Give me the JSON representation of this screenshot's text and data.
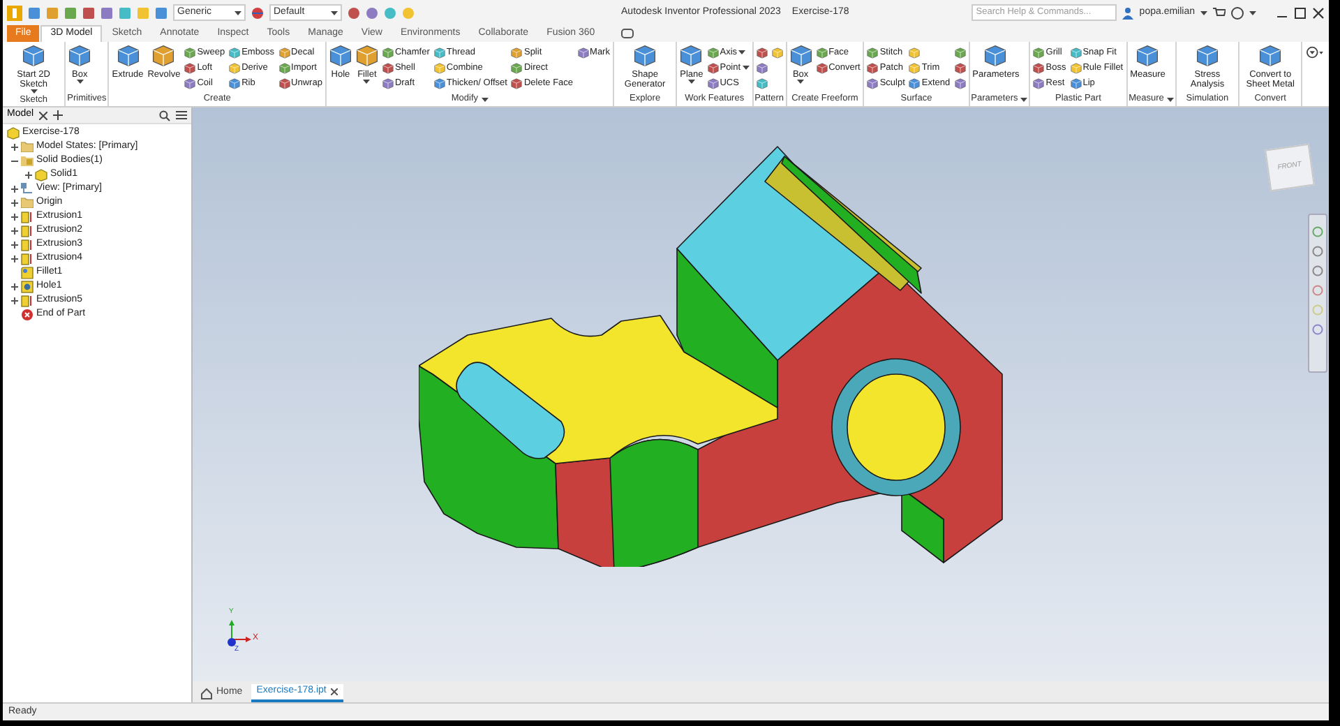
{
  "quick_access": {
    "material": "Generic",
    "appearance": "Default"
  },
  "title": {
    "app": "Autodesk Inventor Professional 2023",
    "document": "Exercise-178"
  },
  "search": {
    "placeholder": "Search Help & Commands..."
  },
  "user": {
    "name": "popa.emilian"
  },
  "tabs": [
    {
      "label": "File",
      "kind": "file",
      "selected": false
    },
    {
      "label": "3D Model",
      "kind": "tab",
      "selected": true
    },
    {
      "label": "Sketch",
      "kind": "tab",
      "selected": false
    },
    {
      "label": "Annotate",
      "kind": "tab",
      "selected": false
    },
    {
      "label": "Inspect",
      "kind": "tab",
      "selected": false
    },
    {
      "label": "Tools",
      "kind": "tab",
      "selected": false
    },
    {
      "label": "Manage",
      "kind": "tab",
      "selected": false
    },
    {
      "label": "View",
      "kind": "tab",
      "selected": false
    },
    {
      "label": "Environments",
      "kind": "tab",
      "selected": false
    },
    {
      "label": "Collaborate",
      "kind": "tab",
      "selected": false
    },
    {
      "label": "Fusion 360",
      "kind": "tab",
      "selected": false
    }
  ],
  "ribbon": [
    {
      "title": "Sketch",
      "menu": false,
      "tools": [
        {
          "kind": "large",
          "label": "Start 2D Sketch",
          "caret": true
        }
      ]
    },
    {
      "title": "Primitives",
      "menu": false,
      "tools": [
        {
          "kind": "large",
          "label": "Box",
          "caret": true
        }
      ]
    },
    {
      "title": "Create",
      "menu": false,
      "tools": [
        {
          "kind": "large",
          "label": "Extrude",
          "caret": false
        },
        {
          "kind": "large",
          "label": "Revolve",
          "caret": false
        },
        {
          "kind": "small",
          "label": "Sweep",
          "caret": false
        },
        {
          "kind": "small",
          "label": "Loft",
          "caret": false
        },
        {
          "kind": "small",
          "label": "Coil",
          "caret": false
        },
        {
          "kind": "small",
          "label": "Emboss",
          "caret": false
        },
        {
          "kind": "small",
          "label": "Derive",
          "caret": false
        },
        {
          "kind": "small",
          "label": "Rib",
          "caret": false
        },
        {
          "kind": "small",
          "label": "Decal",
          "caret": false
        },
        {
          "kind": "small",
          "label": "Import",
          "caret": false
        },
        {
          "kind": "small",
          "label": "Unwrap",
          "caret": false
        }
      ]
    },
    {
      "title": "Modify",
      "menu": true,
      "tools": [
        {
          "kind": "large",
          "label": "Hole",
          "caret": false
        },
        {
          "kind": "large",
          "label": "Fillet",
          "caret": true
        },
        {
          "kind": "small",
          "label": "Chamfer",
          "caret": false
        },
        {
          "kind": "small",
          "label": "Shell",
          "caret": false
        },
        {
          "kind": "small",
          "label": "Draft",
          "caret": false
        },
        {
          "kind": "small",
          "label": "Thread",
          "caret": false
        },
        {
          "kind": "small",
          "label": "Combine",
          "caret": false
        },
        {
          "kind": "small",
          "label": "Thicken/ Offset",
          "caret": false
        },
        {
          "kind": "small",
          "label": "Split",
          "caret": false
        },
        {
          "kind": "small",
          "label": "Direct",
          "caret": false
        },
        {
          "kind": "small",
          "label": "Delete Face",
          "caret": false
        },
        {
          "kind": "small",
          "label": "Mark",
          "caret": false
        }
      ]
    },
    {
      "title": "Explore",
      "menu": false,
      "tools": [
        {
          "kind": "large",
          "label": "Shape Generator",
          "caret": false
        }
      ]
    },
    {
      "title": "Work Features",
      "menu": false,
      "tools": [
        {
          "kind": "large",
          "label": "Plane",
          "caret": true
        },
        {
          "kind": "small",
          "label": "Axis",
          "caret": true
        },
        {
          "kind": "small",
          "label": "Point",
          "caret": true
        },
        {
          "kind": "small",
          "label": "UCS",
          "caret": false
        }
      ]
    },
    {
      "title": "Pattern",
      "menu": false,
      "tools": [
        {
          "kind": "icon",
          "caret": false
        },
        {
          "kind": "icon",
          "caret": false
        },
        {
          "kind": "icon",
          "caret": false
        },
        {
          "kind": "icon",
          "caret": false
        }
      ]
    },
    {
      "title": "Create Freeform",
      "menu": false,
      "tools": [
        {
          "kind": "large",
          "label": "Box",
          "caret": true
        },
        {
          "kind": "small",
          "label": "Face",
          "caret": false
        },
        {
          "kind": "small",
          "label": "Convert",
          "caret": false
        }
      ]
    },
    {
      "title": "Surface",
      "menu": false,
      "tools": [
        {
          "kind": "small",
          "label": "Stitch",
          "caret": false
        },
        {
          "kind": "small",
          "label": "Patch",
          "caret": false
        },
        {
          "kind": "small",
          "label": "Sculpt",
          "caret": false
        },
        {
          "kind": "icon",
          "caret": false
        },
        {
          "kind": "small",
          "label": "Trim",
          "caret": false
        },
        {
          "kind": "small",
          "label": "Extend",
          "caret": false
        },
        {
          "kind": "icon",
          "caret": false
        },
        {
          "kind": "icon",
          "caret": false
        },
        {
          "kind": "icon",
          "caret": false
        }
      ]
    },
    {
      "title": "Parameters",
      "menu": true,
      "tools": [
        {
          "kind": "large",
          "label": "Parameters",
          "caret": false
        }
      ]
    },
    {
      "title": "Plastic Part",
      "menu": false,
      "tools": [
        {
          "kind": "small",
          "label": "Grill",
          "caret": false
        },
        {
          "kind": "small",
          "label": "Boss",
          "caret": false
        },
        {
          "kind": "small",
          "label": "Rest",
          "caret": false
        },
        {
          "kind": "small",
          "label": "Snap Fit",
          "caret": false
        },
        {
          "kind": "small",
          "label": "Rule Fillet",
          "caret": false
        },
        {
          "kind": "small",
          "label": "Lip",
          "caret": false
        }
      ]
    },
    {
      "title": "Measure",
      "menu": true,
      "tools": [
        {
          "kind": "large",
          "label": "Measure",
          "caret": false
        }
      ]
    },
    {
      "title": "Simulation",
      "menu": false,
      "tools": [
        {
          "kind": "large",
          "label": "Stress Analysis",
          "caret": false
        }
      ]
    },
    {
      "title": "Convert",
      "menu": false,
      "tools": [
        {
          "kind": "large",
          "label": "Convert to Sheet Metal",
          "caret": false
        }
      ]
    }
  ],
  "browser": {
    "tab": "Model",
    "tree": [
      {
        "label": "Exercise-178",
        "kind": "part",
        "children": [
          {
            "label": "Model States: [Primary]",
            "kind": "folder",
            "expanded": false
          },
          {
            "label": "Solid Bodies(1)",
            "kind": "bodies",
            "expanded": true,
            "children": [
              {
                "label": "Solid1",
                "kind": "solid",
                "expanded": false
              }
            ]
          },
          {
            "label": "View: [Primary]",
            "kind": "view",
            "expanded": false
          },
          {
            "label": "Origin",
            "kind": "folder",
            "expanded": false
          },
          {
            "label": "Extrusion1",
            "kind": "extrusion",
            "expanded": false
          },
          {
            "label": "Extrusion2",
            "kind": "extrusion",
            "expanded": false
          },
          {
            "label": "Extrusion3",
            "kind": "extrusion",
            "expanded": false
          },
          {
            "label": "Extrusion4",
            "kind": "extrusion",
            "expanded": false
          },
          {
            "label": "Fillet1",
            "kind": "fillet"
          },
          {
            "label": "Hole1",
            "kind": "hole",
            "expanded": false
          },
          {
            "label": "Extrusion5",
            "kind": "extrusion",
            "expanded": false
          },
          {
            "label": "End of Part",
            "kind": "end"
          }
        ]
      }
    ]
  },
  "viewcube": {
    "label": "FRONT"
  },
  "triad": {
    "x": "X",
    "y": "Y",
    "z": "Z"
  },
  "doc_tabs": [
    {
      "label": "Home",
      "kind": "home",
      "selected": false
    },
    {
      "label": "Exercise-178.ipt",
      "kind": "document",
      "selected": true
    }
  ],
  "status_bar": "Ready"
}
